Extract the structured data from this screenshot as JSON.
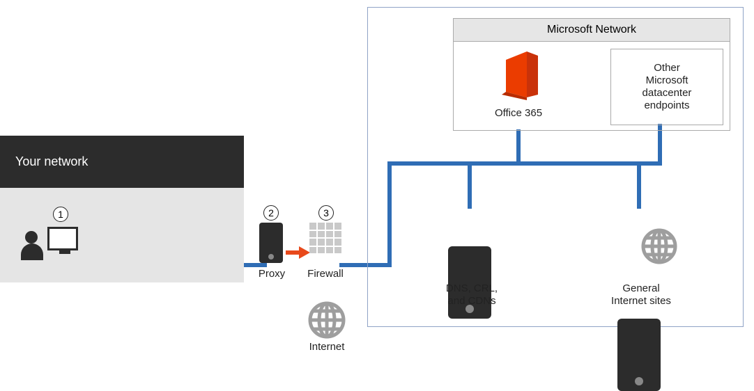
{
  "your_network_title": "Your network",
  "steps": {
    "one": "1",
    "two": "2",
    "three": "3"
  },
  "proxy_label": "Proxy",
  "firewall_label": "Firewall",
  "internet_label": "Internet",
  "dns_label_l1": "DNS, CRL,",
  "dns_label_l2": "and CDNs",
  "sites_label_l1": "General",
  "sites_label_l2": "Internet sites",
  "ms_network_title": "Microsoft Network",
  "office_label": "Office 365",
  "other_endpoints_l1": "Other",
  "other_endpoints_l2": "Microsoft",
  "other_endpoints_l3": "datacenter",
  "other_endpoints_l4": "endpoints"
}
